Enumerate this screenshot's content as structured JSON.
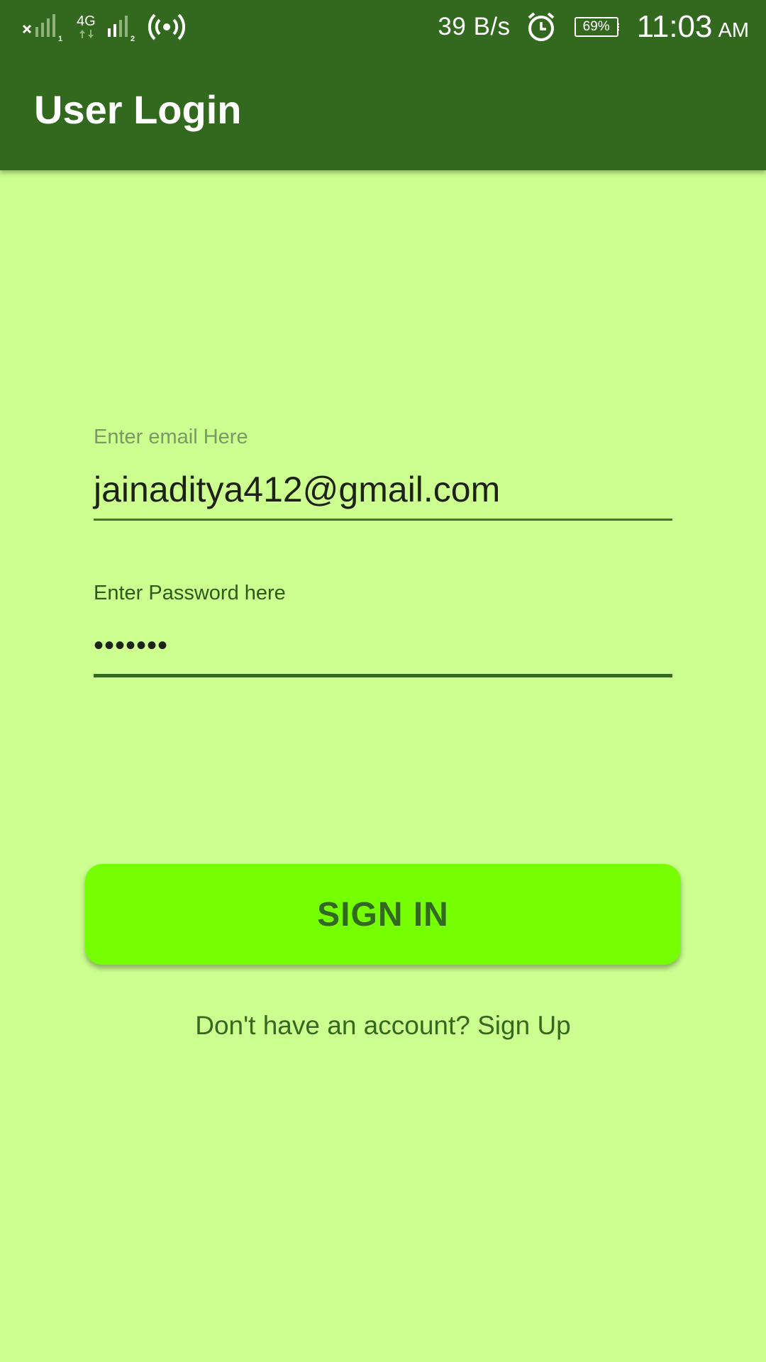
{
  "status_bar": {
    "network_speed": "39 B/s",
    "battery_percent": "69%",
    "battery_level": 0.69,
    "time": "11:03",
    "ampm": "AM",
    "icons": [
      "sim1-no-signal-icon",
      "4g-data-icon",
      "sim2-signal-icon",
      "hotspot-icon",
      "alarm-icon",
      "battery-icon"
    ]
  },
  "app_bar": {
    "title": "User Login",
    "color": "#33691e"
  },
  "form": {
    "email_label": "Enter email Here",
    "email_value": "jainaditya412@gmail.com",
    "password_label": "Enter Password here",
    "password_value": "•••••••"
  },
  "actions": {
    "sign_in_label": "SIGN IN",
    "sign_up_prompt": "Don't have an account? Sign Up"
  },
  "theme": {
    "background": "#ccff90",
    "primary_dark": "#33691e",
    "button": "#76ff03"
  }
}
